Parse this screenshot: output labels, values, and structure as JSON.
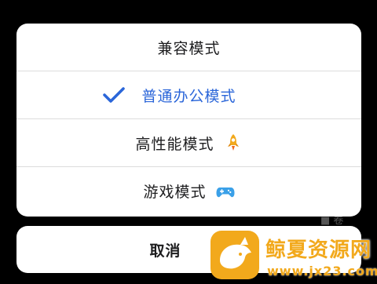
{
  "sheet": {
    "options": [
      {
        "label": "兼容模式",
        "selected": false,
        "icon": ""
      },
      {
        "label": "普通办公模式",
        "selected": true,
        "icon": "checkmark-icon"
      },
      {
        "label": "高性能模式",
        "selected": false,
        "icon": "rocket-icon"
      },
      {
        "label": "游戏模式",
        "selected": false,
        "icon": "gamepad-icon"
      }
    ]
  },
  "cancel": {
    "label": "取消"
  },
  "background": {
    "glyph": "■ 卷"
  },
  "watermark": {
    "title": "鲸夏资源网",
    "url": "www.jx23.com",
    "logo": "whale-logo"
  },
  "colors": {
    "accent": "#2b66d9",
    "rocket": "#f2a91c",
    "gamepad": "#3aa0e8",
    "watermark": "#f2a91c",
    "backdrop": "#000000"
  }
}
